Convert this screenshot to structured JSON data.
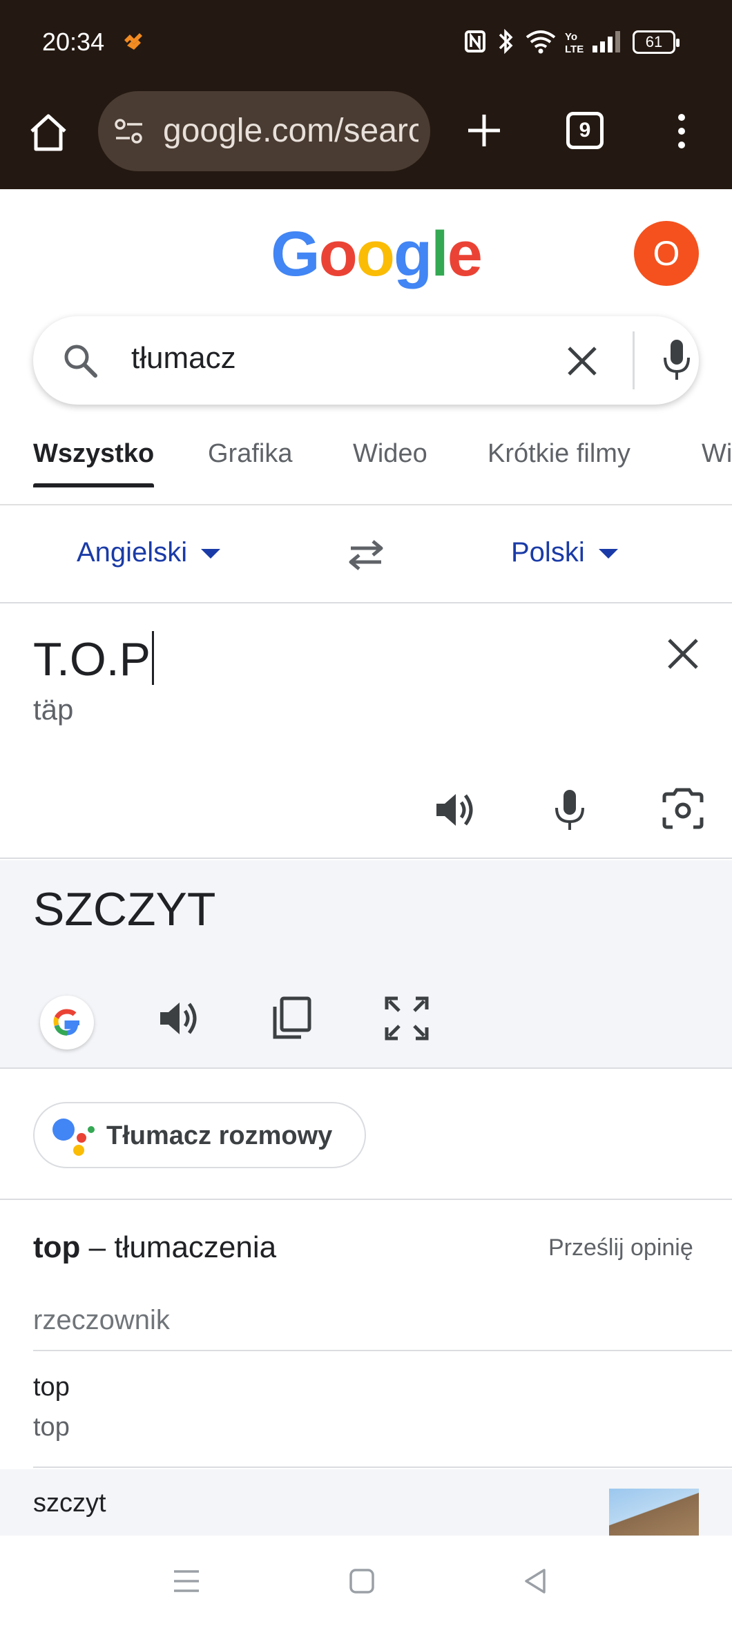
{
  "status_bar": {
    "time": "20:34",
    "battery": "61",
    "icons": [
      "app-notification-icon",
      "nfc-icon",
      "bluetooth-icon",
      "wifi-icon",
      "volte-icon",
      "signal-icon",
      "battery-icon"
    ]
  },
  "browser": {
    "url": "google.com/search",
    "tab_count": "9",
    "icons": [
      "home-icon",
      "site-settings-icon",
      "new-tab-icon",
      "tab-switcher-icon",
      "more-menu-icon"
    ]
  },
  "google": {
    "logo": [
      "G",
      "o",
      "o",
      "g",
      "l",
      "e"
    ],
    "logo_colors": [
      "#4285F4",
      "#EA4335",
      "#FBBC05",
      "#4285F4",
      "#34A853",
      "#EA4335"
    ],
    "avatar_initial": "O",
    "avatar_color": "#f4511e"
  },
  "search": {
    "query": "tłumacz"
  },
  "tabs": [
    "Wszystko",
    "Grafika",
    "Wideo",
    "Krótkie filmy",
    "Wiadomości"
  ],
  "translate": {
    "source_lang": "Angielski",
    "target_lang": "Polski",
    "source_text": "T.O.P",
    "transliteration": "täp",
    "target_text": "SZCZYT",
    "link_color": "#1a3ba7"
  },
  "conversation": {
    "label": "Tłumacz rozmowy"
  },
  "dictionary": {
    "head_word": "top",
    "head_suffix": " – tłumaczenia",
    "feedback": "Prześlij opinię",
    "part_of_speech": "rzeczownik",
    "entries": [
      {
        "translation": "top",
        "back": "top"
      },
      {
        "translation": "szczyt",
        "back": ""
      }
    ]
  }
}
